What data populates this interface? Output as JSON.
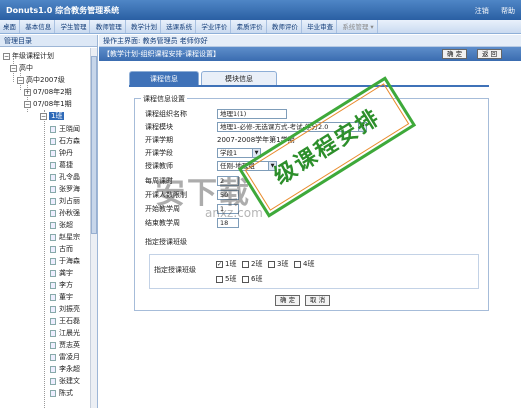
{
  "titlebar": {
    "app_title": "Donuts1.0 综合教务管理系统",
    "links": [
      "注销",
      "帮助"
    ]
  },
  "menu": {
    "items": [
      "桌面",
      "基本信息",
      "学生管理",
      "教师管理",
      "教学计划",
      "选课系统",
      "学业评价",
      "素质评价",
      "教师评价",
      "毕业审查",
      "系统管理 ▾"
    ]
  },
  "left": {
    "header": "管理目录",
    "tree": {
      "n0": "年级课程计划",
      "n1": "高中",
      "n2": "高中2007级",
      "n3": "07/08年2期",
      "n4": "07/08年1期",
      "n5": "1班",
      "teachers": [
        "王晓闻",
        "石方森",
        "钟丹",
        "葛捷",
        "孔令晶",
        "张罗海",
        "刘占丽",
        "孙秋强",
        "张超",
        "赵星宗",
        "古而",
        "于海森",
        "龚宇",
        "李方",
        "董宇",
        "刘振亮",
        "王石磊",
        "江晨光",
        "贾志英",
        "雷凌月",
        "李永超",
        "张建文",
        "陈式"
      ]
    }
  },
  "right": {
    "crumb": "操作主界面: 教务管理员 老师你好",
    "path": "【教学计划-组织课程安排-课程设置】",
    "buttons": {
      "ok": "确 定",
      "back": "返 回"
    },
    "tabs": [
      "课程信息",
      "模块信息"
    ],
    "form": {
      "legend": "课程信息设置",
      "fields": {
        "course_name": {
          "label": "课程组织名称",
          "value": "地理1(1)"
        },
        "module": {
          "label": "课程模块",
          "value": "地理1-必修-无选课方式-考试-学分2.0"
        },
        "term": {
          "label": "开课学期",
          "value": "2007-2008学年第1学期"
        },
        "section": {
          "label": "开课学段",
          "value": "学段1"
        },
        "teacher": {
          "label": "授课教师",
          "value": "任刚-地理组"
        },
        "weekly": {
          "label": "每周课时",
          "value": "2"
        },
        "limit": {
          "label": "开课人数限制",
          "value": "50"
        },
        "start_week": {
          "label": "开始教学周",
          "value": "1"
        },
        "end_week": {
          "label": "结束教学周",
          "value": "18"
        }
      },
      "class_section": {
        "label_top": "指定授课班级",
        "label": "指定授课班级",
        "classes": [
          {
            "name": "1班",
            "checked": true
          },
          {
            "name": "2班",
            "checked": false
          },
          {
            "name": "3班",
            "checked": false
          },
          {
            "name": "4班",
            "checked": false
          },
          {
            "name": "5班",
            "checked": false
          },
          {
            "name": "6班",
            "checked": false
          }
        ]
      },
      "confirm": "确 定",
      "cancel": "取 消"
    }
  },
  "watermark": {
    "cn": "安下载",
    "url": "anxz.com"
  },
  "stamp": "级课程安排"
}
